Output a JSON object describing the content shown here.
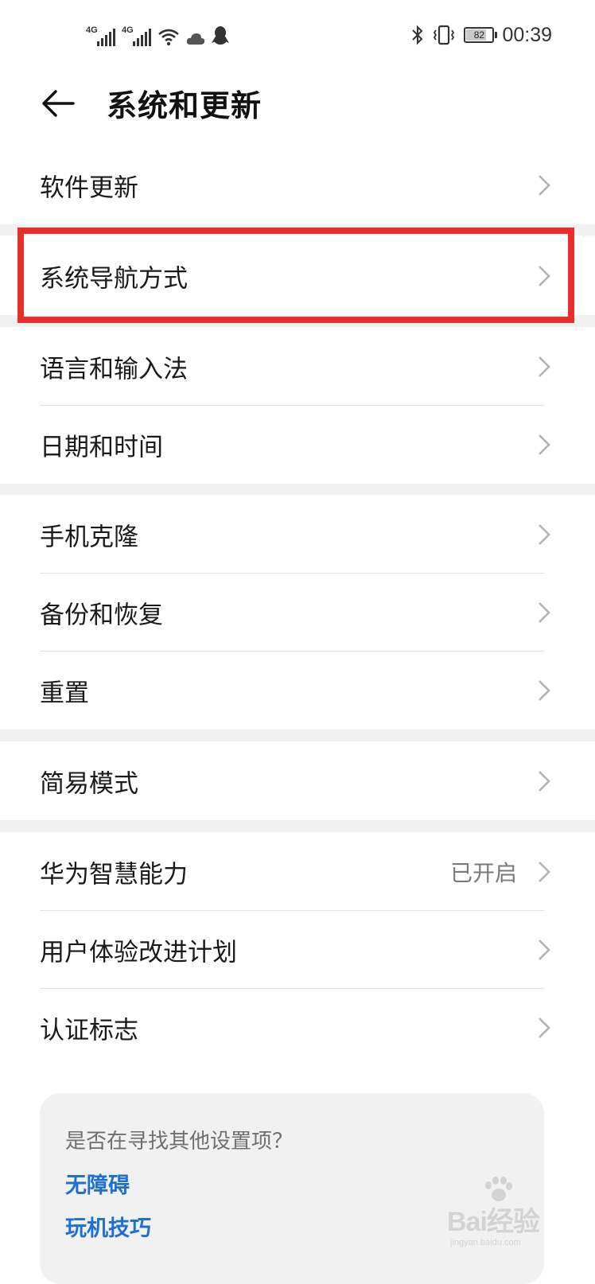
{
  "status_bar": {
    "network_1": "4G",
    "network_2": "4G",
    "battery_level": "82",
    "battery_fraction": 0.82,
    "time": "00:39",
    "icons": [
      "signal-icon",
      "signal-icon",
      "wifi-icon",
      "cloud-icon",
      "qq-icon",
      "bluetooth-icon",
      "vibrate-icon",
      "battery-icon"
    ]
  },
  "header": {
    "back_icon": "back-arrow-icon",
    "title": "系统和更新"
  },
  "groups": [
    {
      "items": [
        {
          "label": "软件更新"
        }
      ]
    },
    {
      "items": [
        {
          "label": "系统导航方式",
          "highlighted": true
        }
      ]
    },
    {
      "items": [
        {
          "label": "语言和输入法"
        },
        {
          "label": "日期和时间"
        }
      ]
    },
    {
      "items": [
        {
          "label": "手机克隆"
        },
        {
          "label": "备份和恢复"
        },
        {
          "label": "重置"
        }
      ]
    },
    {
      "items": [
        {
          "label": "简易模式"
        }
      ]
    },
    {
      "items": [
        {
          "label": "华为智慧能力",
          "value": "已开启"
        },
        {
          "label": "用户体验改进计划"
        },
        {
          "label": "认证标志"
        }
      ]
    }
  ],
  "suggestion_card": {
    "question": "是否在寻找其他设置项？",
    "links": [
      "无障碍",
      "玩机技巧"
    ]
  },
  "watermark": {
    "text": "Bai经验",
    "sub": "jingyan.baidu.com"
  },
  "colors": {
    "highlight_border": "#e8302a",
    "link": "#1f6fd1",
    "separator": "#f1f1f1"
  }
}
